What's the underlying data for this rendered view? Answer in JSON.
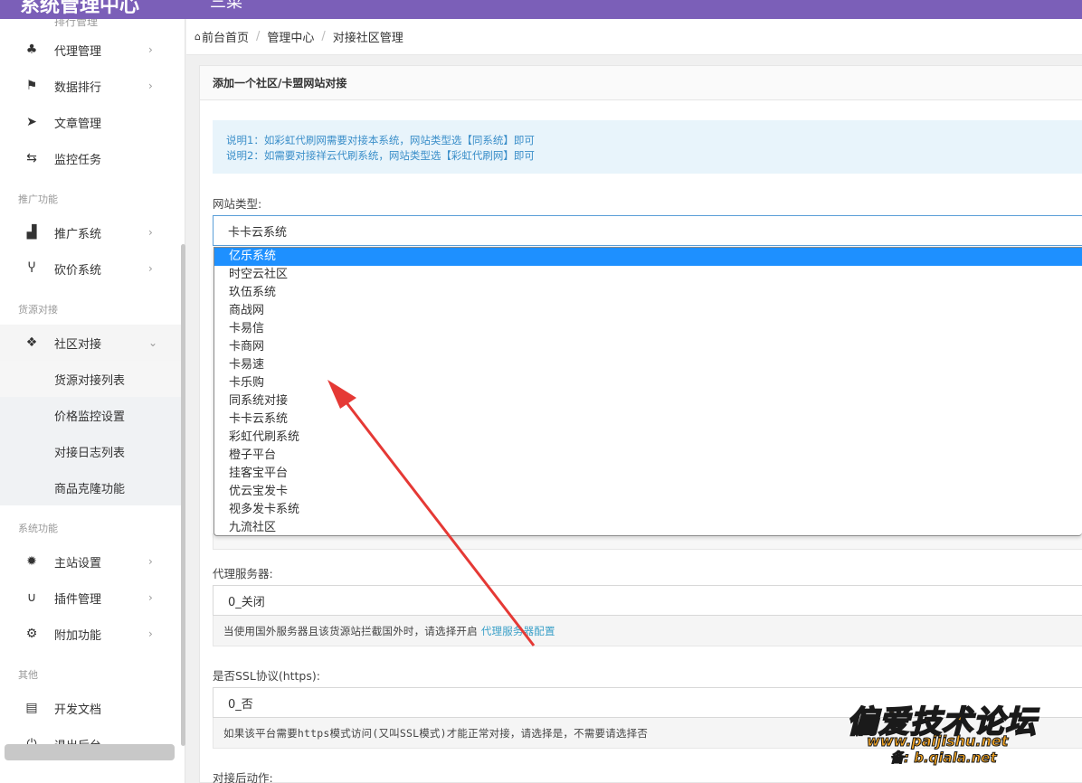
{
  "topbar": {
    "brand": "系统管理中心",
    "brand_tail": "三菜"
  },
  "sidebar": {
    "cut_item": "排行管理",
    "items": [
      {
        "icon": "sitemap-icon",
        "glyph": "♣",
        "label": "代理管理",
        "chevron": "›"
      },
      {
        "icon": "flag-icon",
        "glyph": "⚑",
        "label": "数据排行",
        "chevron": "›"
      },
      {
        "icon": "paper-plane-icon",
        "glyph": "➤",
        "label": "文章管理",
        "chevron": ""
      },
      {
        "icon": "retweet-icon",
        "glyph": "⇆",
        "label": "监控任务",
        "chevron": ""
      }
    ],
    "section_promo": "推广功能",
    "promo_items": [
      {
        "icon": "industry-icon",
        "glyph": "▟",
        "label": "推广系统",
        "chevron": "›"
      },
      {
        "icon": "cutlery-icon",
        "glyph": "Ⴤ",
        "label": "砍价系统",
        "chevron": "›"
      }
    ],
    "section_source": "货源对接",
    "community": {
      "icon": "cubes-icon",
      "glyph": "❖",
      "label": "社区对接",
      "chevron": "⌄"
    },
    "sub_items": [
      "货源对接列表",
      "价格监控设置",
      "对接日志列表",
      "商品克隆功能"
    ],
    "section_system": "系统功能",
    "system_items": [
      {
        "icon": "gear-icon",
        "glyph": "✹",
        "label": "主站设置",
        "chevron": "›"
      },
      {
        "icon": "magnet-icon",
        "glyph": "∪",
        "label": "插件管理",
        "chevron": "›"
      },
      {
        "icon": "gears-icon",
        "glyph": "⚙",
        "label": "附加功能",
        "chevron": "›"
      }
    ],
    "section_other": "其他",
    "other_items": [
      {
        "icon": "document-icon",
        "glyph": "▤",
        "label": "开发文档"
      },
      {
        "icon": "power-icon",
        "glyph": "⏻",
        "label": "退出后台"
      }
    ]
  },
  "breadcrumb": {
    "home": "前台首页",
    "mid": "管理中心",
    "current": "对接社区管理",
    "sep": "/"
  },
  "panel": {
    "title": "添加一个社区/卡盟网站对接"
  },
  "notice": {
    "line1": "说明1：如彩虹代刷网需要对接本系统，网站类型选【同系统】即可",
    "line2": "说明2：如需要对接祥云代刷系统，网站类型选【彩虹代刷网】即可"
  },
  "site_type": {
    "label": "网站类型:",
    "value": "卡卡云系统",
    "options": [
      "亿乐系统",
      "时空云社区",
      "玖伍系统",
      "商战网",
      "卡易信",
      "卡商网",
      "卡易速",
      "卡乐购",
      "同系统对接",
      "卡卡云系统",
      "彩虹代刷系统",
      "橙子平台",
      "挂客宝平台",
      "优云宝发卡",
      "视多发卡系统",
      "九流社区"
    ],
    "highlighted": "亿乐系统"
  },
  "proxy": {
    "label": "代理服务器:",
    "value": "0_关闭",
    "help": "当使用国外服务器且该货源站拦截国外时，请选择开启",
    "help_link": "代理服务器配置"
  },
  "ssl": {
    "label": "是否SSL协议(https):",
    "value": "0_否",
    "help": "如果该平台需要https模式访问(又叫SSL模式)才能正常对接，请选择是，不需要请选择否"
  },
  "after_action": {
    "label": "对接后动作:"
  },
  "watermark": {
    "main": "偏爱技术论坛",
    "url": "www.paijishu.net",
    "sub": "备: b.qiala.net"
  },
  "colors": {
    "topbar": "#7b5fb8",
    "highlight": "#1e90ff",
    "arrow": "#e53935",
    "notice_text": "#3a8ec9"
  }
}
